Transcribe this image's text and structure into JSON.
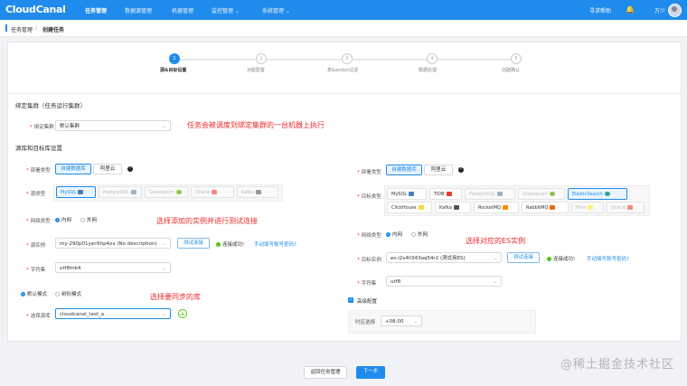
{
  "topbar": {
    "logo": "CloudCanal",
    "nav": [
      "任务管理",
      "数据源管理",
      "机器管理",
      "监控管理 ⌄",
      "系统管理 ⌄"
    ],
    "help": "寻求帮助",
    "user": "万少"
  },
  "breadcrumb": {
    "parent": "任务管理",
    "sep": "/",
    "current": "创建任务"
  },
  "steps": [
    {
      "num": "1",
      "label": "源&目标设置"
    },
    {
      "num": "2",
      "label": "功能配置"
    },
    {
      "num": "3",
      "label": "表&action过滤"
    },
    {
      "num": "4",
      "label": "数据处理"
    },
    {
      "num": "5",
      "label": "创建确认"
    }
  ],
  "cluster": {
    "section": "绑定集群（任务运行集群）",
    "label": "绑定集群",
    "value": "默认集群",
    "annotation": "任务会被调度到绑定集群的一台机器上执行"
  },
  "db_section": "源库和目标库设置",
  "source": {
    "deploy_label": "部署类型",
    "deploy_options": [
      "自建数据库",
      "阿里云"
    ],
    "type_label": "源类型",
    "types": [
      "MySQL",
      "PostgreSQL",
      "Greenplum",
      "Oracle",
      "Kafka"
    ],
    "net_label": "网络类型",
    "net_options": [
      "内网",
      "外网"
    ],
    "net_annotation": "选择添加的实例并进行测试连接",
    "instance_label": "源实例",
    "instance_value": "my-290p01yec6hp4xx (No description)",
    "test_btn": "测试连接",
    "status": "连接成功!",
    "manual_link": "手动填写账号密码?",
    "charset_label": "字符集",
    "charset_value": "utf8mb4",
    "mode_options": [
      "默认模式",
      "树形模式"
    ],
    "mode_annotation": "选择要同步的库",
    "db_label": "选择源库",
    "db_value": "cloudcanal_test_a"
  },
  "target": {
    "deploy_label": "部署类型",
    "deploy_options": [
      "自建数据库",
      "阿里云"
    ],
    "type_label": "目标类型",
    "types_row1": [
      "MySQL",
      "TiDB",
      "PostgreSQL",
      "Greenplum",
      "ElasticSearch"
    ],
    "types_row2": [
      "ClickHouse",
      "Kafka",
      "RocketMQ",
      "RabbitMQ",
      "Hive",
      "Oracle"
    ],
    "net_label": "网络类型",
    "net_options": [
      "内网",
      "外网"
    ],
    "instance_annotation": "选择对应的ES实例",
    "instance_label": "目标实例",
    "instance_value": "es-i2v4ll343aq54r2 (測式用ES)",
    "test_btn": "测试连接",
    "status": "连接成功!",
    "manual_link": "手动填写账号密码?",
    "charset_label": "字符集",
    "charset_value": "utf8",
    "advanced_label": "高级配置",
    "tz_label": "时区选择",
    "tz_value": "+08:00"
  },
  "footer": {
    "back": "返回任务管理",
    "next": "下一步"
  },
  "watermark": "@稀土掘金技术社区",
  "colors": {
    "primary": "#1f8bec",
    "annotation": "#ee2a2a",
    "success": "#52c41a"
  }
}
